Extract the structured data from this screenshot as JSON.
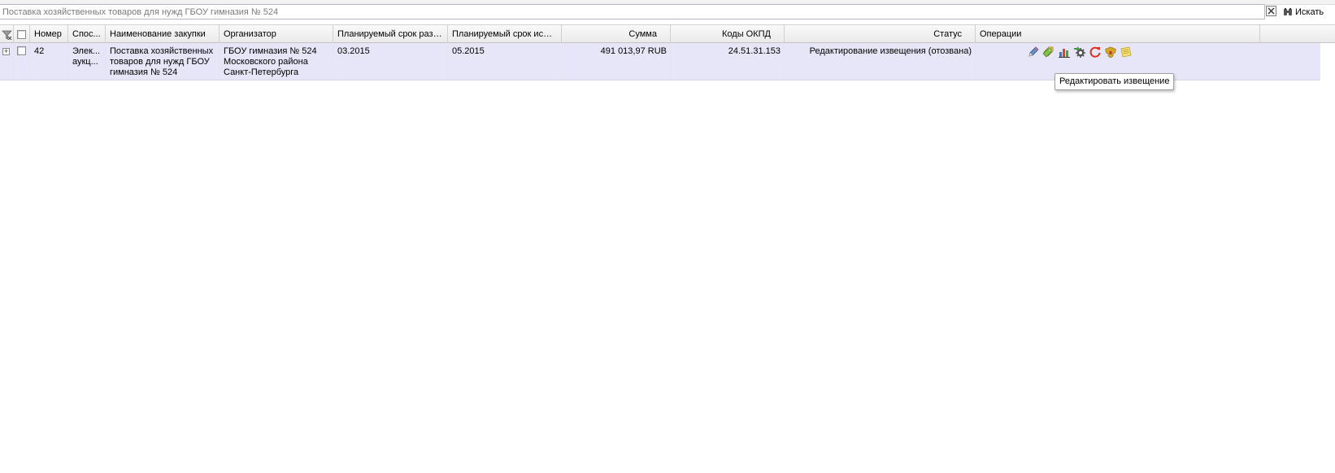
{
  "search": {
    "value": "Поставка хозяйственных товаров для нужд ГБОУ гимназия № 524",
    "button_label": "Искать",
    "clear_icon": "close-icon",
    "button_icon": "binoculars-icon"
  },
  "grid": {
    "columns": {
      "number": "Номер",
      "method": "Спос...",
      "name": "Наименование закупки",
      "organizer": "Организатор",
      "planned_placement": "Планируемый срок разм...",
      "planned_execution": "Планируемый срок испо...",
      "sum": "Сумма",
      "okpd": "Коды ОКПД",
      "status": "Статус",
      "operations": "Операции"
    },
    "rows": [
      {
        "number": "42",
        "method": [
          "Элек...",
          "аукц..."
        ],
        "name": [
          "Поставка хозяйственных",
          "товаров для нужд ГБОУ",
          "гимназия № 524"
        ],
        "organizer": [
          "ГБОУ гимназия № 524",
          "Московского района",
          "Санкт-Петербурга"
        ],
        "planned_placement": "03.2015",
        "planned_execution": "05.2015",
        "sum": "491 013,97 RUB",
        "okpd": "24.51.31.153",
        "status": "Редактирование извещения (отозвана)"
      }
    ]
  },
  "tooltip": "Редактировать извещение",
  "colors": {
    "row_selected": "#e6e6f8",
    "header_bg": "#eaeaea"
  }
}
